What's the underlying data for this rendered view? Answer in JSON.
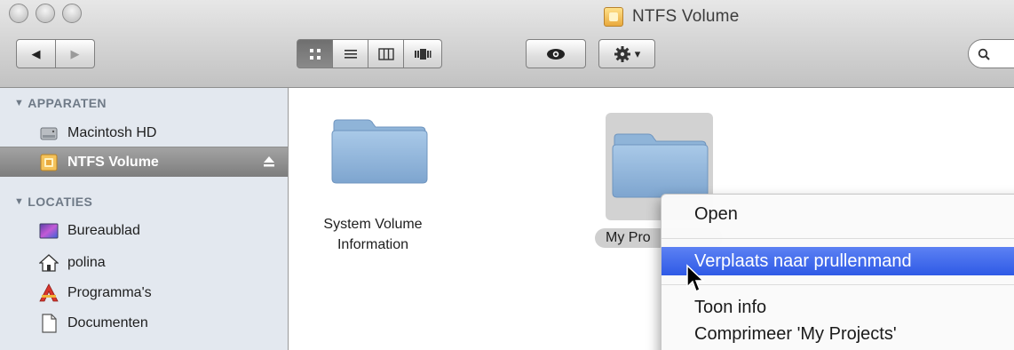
{
  "window": {
    "title": "NTFS Volume",
    "title_icon": "drive-icon"
  },
  "toolbar": {
    "back_icon": "◀",
    "forward_icon": "▶",
    "view_buttons": [
      {
        "name": "icon-view",
        "glyph": "∷",
        "active": true
      },
      {
        "name": "list-view",
        "glyph": "≡",
        "active": false
      },
      {
        "name": "column-view",
        "glyph": "◫",
        "active": false
      },
      {
        "name": "coverflow-view",
        "glyph": "|■|",
        "active": false
      }
    ],
    "quicklook_glyph": "◉",
    "action_glyph": "✱",
    "action_caret": "▾",
    "search_glyph": "Q"
  },
  "sidebar": {
    "sections": [
      {
        "label": "APPARATEN",
        "items": [
          {
            "label": "Macintosh HD",
            "icon": "hard-drive-icon",
            "selected": false
          },
          {
            "label": "NTFS Volume",
            "icon": "ntfs-drive-icon",
            "selected": true,
            "eject": true
          }
        ]
      },
      {
        "label": "LOCATIES",
        "items": [
          {
            "label": "Bureaublad",
            "icon": "desktop-icon",
            "selected": false
          },
          {
            "label": "polina",
            "icon": "home-icon",
            "selected": false
          },
          {
            "label": "Programma's",
            "icon": "applications-icon",
            "selected": false
          },
          {
            "label": "Documenten",
            "icon": "documents-icon",
            "selected": false
          }
        ]
      }
    ],
    "collapse_glyph": "▼",
    "eject_glyph": "⏏"
  },
  "content": {
    "files": [
      {
        "name_line1": "System Volume",
        "name_line2": "Information",
        "type": "folder",
        "selected": false
      },
      {
        "name": "My Projects",
        "name_visible": "My Pro",
        "type": "folder",
        "selected": true
      }
    ]
  },
  "context_menu": {
    "items": [
      {
        "label": "Open",
        "highlighted": false
      },
      {
        "label": "Verplaats naar prullenmand",
        "highlighted": true
      },
      {
        "label": "Toon info",
        "highlighted": false
      },
      {
        "label": "Comprimeer 'My Projects'",
        "highlighted": false
      }
    ],
    "highlight_color": "#3e68ec"
  },
  "colors": {
    "sidebar_bg": "#e3e8ef",
    "sidebar_header": "#6f7a87",
    "selection_gray": "#8a8a8a",
    "folder_blue": "#8fb4d8"
  }
}
